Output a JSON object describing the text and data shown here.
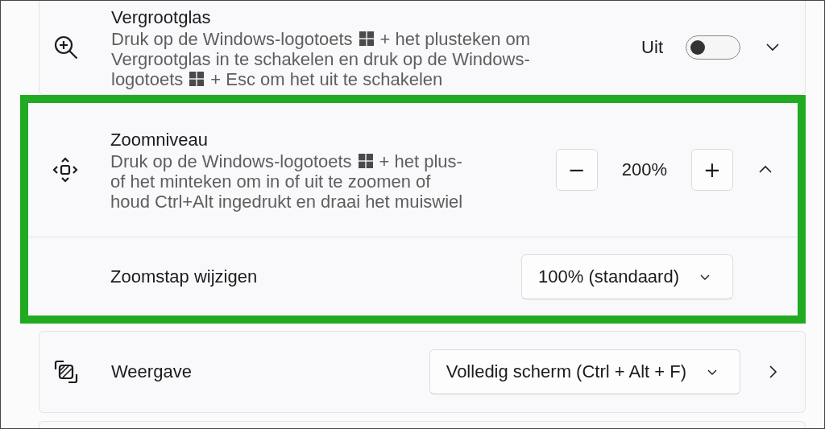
{
  "settings": [
    {
      "title": "Vergrootglas",
      "kind": "toggle",
      "state_label": "Uit",
      "on": false,
      "expanded": false,
      "highlighted": false,
      "description": [
        [
          {
            "kind": "text",
            "text": "Druk op de Windows-logotoets"
          },
          {
            "kind": "logo"
          },
          {
            "kind": "text",
            "text": "+ het plusteken om"
          }
        ],
        [
          {
            "kind": "text",
            "text": "Vergrootglas in te schakelen en druk op de Windows-"
          }
        ],
        [
          {
            "kind": "text",
            "text": "logotoets"
          },
          {
            "kind": "logo"
          },
          {
            "kind": "text",
            "text": "+ Esc om het uit te schakelen"
          }
        ]
      ]
    },
    {
      "title": "Zoomniveau",
      "kind": "stepper",
      "minus": "−",
      "value": "200%",
      "plus": "+",
      "expanded": true,
      "highlighted": true,
      "description": [
        [
          {
            "kind": "text",
            "text": "Druk op de Windows-logotoets"
          },
          {
            "kind": "logo"
          },
          {
            "kind": "text",
            "text": "+ het plus-"
          }
        ],
        [
          {
            "kind": "text",
            "text": "of het minteken om in of uit te zoomen of"
          }
        ],
        [
          {
            "kind": "text",
            "text": "houd Ctrl+Alt ingedrukt en draai het muiswiel"
          }
        ]
      ],
      "sub_settings": [
        {
          "title": "Zoomstap wijzigen",
          "kind": "dropdown",
          "value": "100% (standaard)"
        }
      ]
    },
    {
      "title": "Weergave",
      "kind": "dropdown",
      "value": "Volledig scherm (Ctrl + Alt + F)",
      "opens_page": true,
      "highlighted": false
    }
  ]
}
